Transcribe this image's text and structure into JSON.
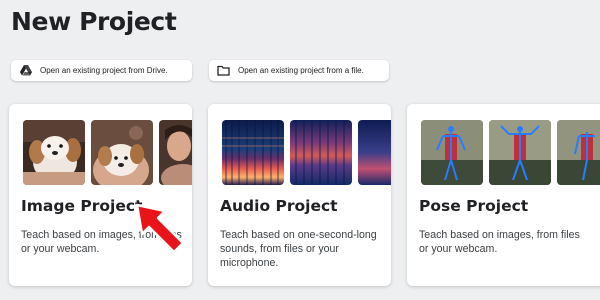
{
  "page": {
    "title": "New Project"
  },
  "buttons": {
    "open_drive": {
      "label": "Open an existing project from Drive.",
      "icon": "google-drive-icon"
    },
    "open_file": {
      "label": "Open an existing project from a file.",
      "icon": "folder-icon"
    }
  },
  "cards": {
    "image": {
      "title": "Image Project",
      "description": "Teach based on images, from files or your webcam."
    },
    "audio": {
      "title": "Audio Project",
      "description": "Teach based on one-second-long sounds, from files or your microphone."
    },
    "pose": {
      "title": "Pose Project",
      "description": "Teach based on images, from files or your webcam."
    }
  },
  "colors": {
    "background": "#eeeff1",
    "card": "#ffffff",
    "cursor": "#e8141a"
  }
}
